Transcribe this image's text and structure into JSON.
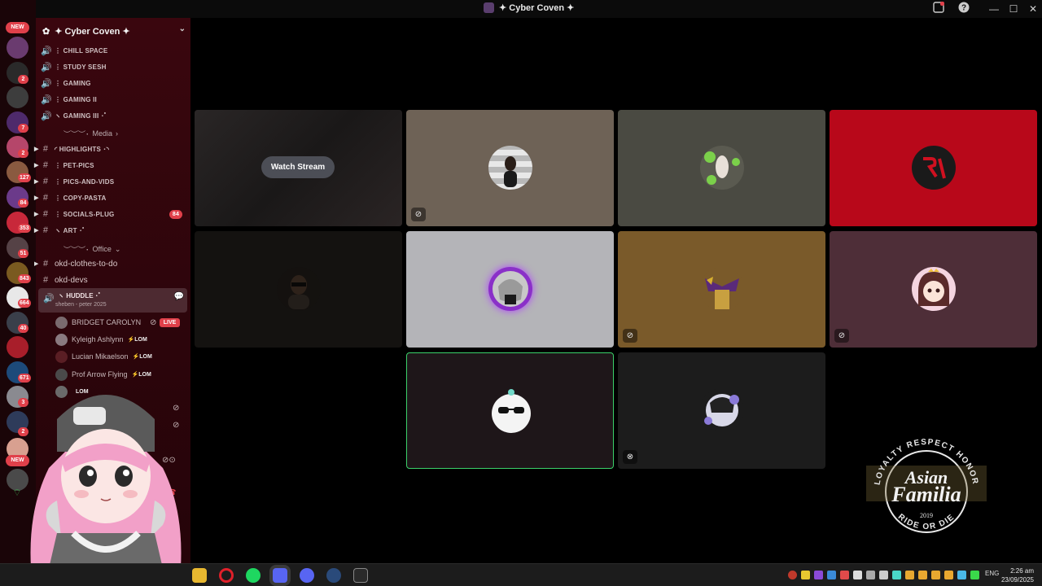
{
  "window": {
    "title": "✦ Cyber Coven ✦"
  },
  "rail": {
    "badges": [
      "2",
      "2",
      "7",
      "2",
      "127",
      "84",
      "353",
      "51",
      "843",
      "664",
      "40",
      "671",
      "3",
      "2"
    ],
    "new_top": "NEW",
    "new_bottom": "NEW"
  },
  "guild": {
    "name": "✦ Cyber Coven ✦"
  },
  "channels": {
    "voice1": "⋮ CHILL SPACE",
    "voice2": "⋮ STUDY SESH",
    "voice3": "⋮ GAMING",
    "voice4": "⋮ GAMING II",
    "voice5": "ヽ GAMING III ･ﾟ",
    "cat_media": "Media",
    "text1": "◜ HIGHLIGHTS ･◝",
    "text2": "⋮ PET-PICS",
    "text3": "⋮ PICS-AND-VIDS",
    "text4": "⋮ COPY-PASTA",
    "text5": "⋮ SOCIALS-PLUG",
    "text5_badge": "84",
    "text6": "ヽ ART ･ﾟ",
    "cat_office": "Office",
    "text7": "okd-clothes-to-do",
    "text8": "okd-devs",
    "huddle": "ヽ HUDDLE ･ﾟ",
    "huddle_sub": "sheben - peter 2025"
  },
  "voice_users": [
    {
      "name": "BRIDGET CAROLYN",
      "tag": "LIVE"
    },
    {
      "name": "Kyleigh Ashlynn",
      "tag": "⚡LOM"
    },
    {
      "name": "Lucian Mikaelson",
      "tag": "⚡LOM"
    },
    {
      "name": "Prof Arrow Flying",
      "tag": "⚡LOM"
    },
    {
      "name": "",
      "tag": "LOM"
    }
  ],
  "stage": {
    "watch_stream": "Watch Stream"
  },
  "logo": {
    "top_text": "LOYALTY RESPECT HONOR",
    "line1": "Asian",
    "line2": "Familia",
    "year": "2019",
    "bottom_text": "RIDE OR DIE"
  },
  "taskbar": {
    "lang": "ENG",
    "time": "2:26 am",
    "date": "23/09/2025"
  },
  "icons": {
    "deafen": "headset-off-icon",
    "mute": "mic-off-icon",
    "video": "video-off-icon"
  }
}
